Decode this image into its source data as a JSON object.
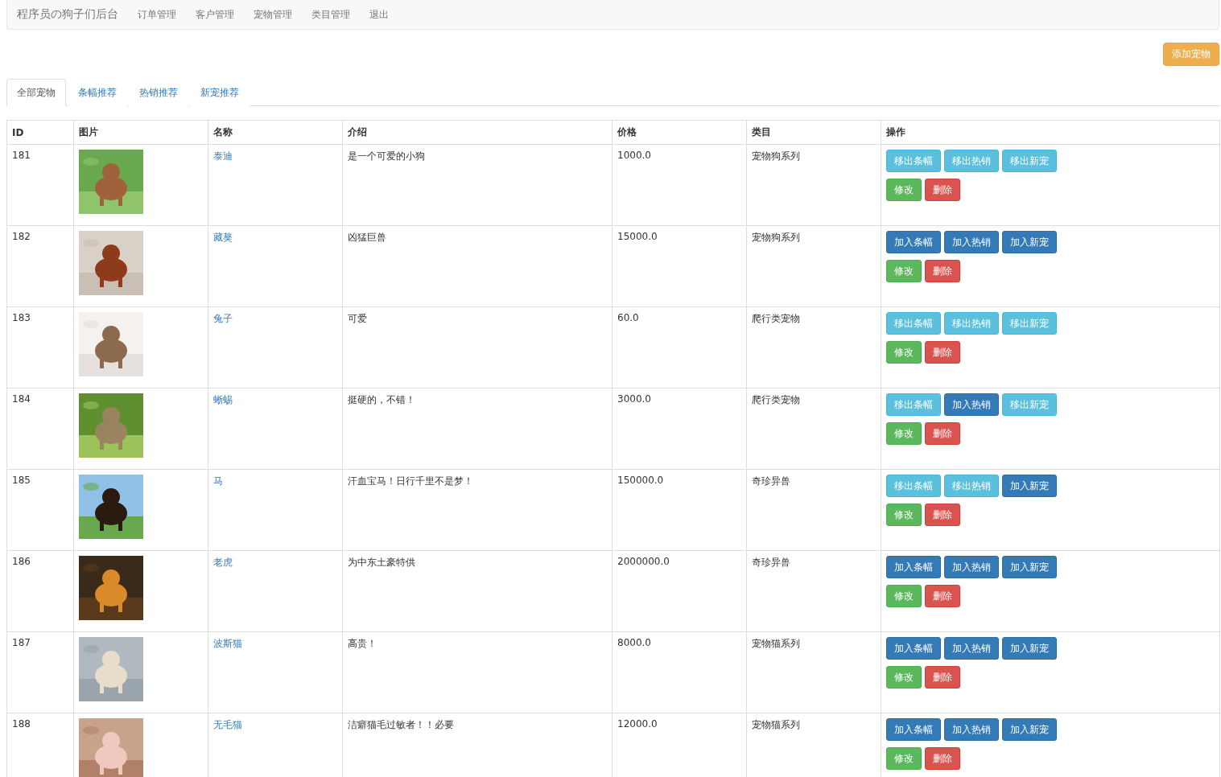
{
  "navbar": {
    "brand": "程序员の狗子们后台",
    "items": [
      "订单管理",
      "客户管理",
      "宠物管理",
      "类目管理",
      "退出"
    ]
  },
  "add_button": "添加宠物",
  "tabs": [
    {
      "label": "全部宠物",
      "selected": true
    },
    {
      "label": "条幅推荐",
      "selected": false
    },
    {
      "label": "热销推荐",
      "selected": false
    },
    {
      "label": "新宠推荐",
      "selected": false
    }
  ],
  "table": {
    "columns": [
      "ID",
      "图片",
      "名称",
      "介绍",
      "价格",
      "类目",
      "操作"
    ],
    "rows": [
      {
        "id": "181",
        "name": "泰迪",
        "intro": "是一个可爱的小狗",
        "price": "1000.0",
        "category": "宠物狗系列",
        "actions": [
          {
            "label": "移出条幅",
            "kind": "remove"
          },
          {
            "label": "移出热销",
            "kind": "remove"
          },
          {
            "label": "移出新宠",
            "kind": "remove"
          },
          {
            "label": "修改",
            "kind": "edit"
          },
          {
            "label": "删除",
            "kind": "delete"
          }
        ]
      },
      {
        "id": "182",
        "name": "藏獒",
        "intro": "凶猛巨兽",
        "price": "15000.0",
        "category": "宠物狗系列",
        "actions": [
          {
            "label": "加入条幅",
            "kind": "add"
          },
          {
            "label": "加入热销",
            "kind": "add"
          },
          {
            "label": "加入新宠",
            "kind": "add"
          },
          {
            "label": "修改",
            "kind": "edit"
          },
          {
            "label": "删除",
            "kind": "delete"
          }
        ]
      },
      {
        "id": "183",
        "name": "兔子",
        "intro": "可爱",
        "price": "60.0",
        "category": "爬行类宠物",
        "actions": [
          {
            "label": "移出条幅",
            "kind": "remove"
          },
          {
            "label": "移出热销",
            "kind": "remove"
          },
          {
            "label": "移出新宠",
            "kind": "remove"
          },
          {
            "label": "修改",
            "kind": "edit"
          },
          {
            "label": "删除",
            "kind": "delete"
          }
        ]
      },
      {
        "id": "184",
        "name": "蜥蜴",
        "intro": "挺硬的，不错！",
        "price": "3000.0",
        "category": "爬行类宠物",
        "actions": [
          {
            "label": "移出条幅",
            "kind": "remove"
          },
          {
            "label": "加入热销",
            "kind": "add"
          },
          {
            "label": "移出新宠",
            "kind": "remove"
          },
          {
            "label": "修改",
            "kind": "edit"
          },
          {
            "label": "删除",
            "kind": "delete"
          }
        ]
      },
      {
        "id": "185",
        "name": "马",
        "intro": "汗血宝马！日行千里不是梦！",
        "price": "150000.0",
        "category": "奇珍异兽",
        "actions": [
          {
            "label": "移出条幅",
            "kind": "remove"
          },
          {
            "label": "移出热销",
            "kind": "remove"
          },
          {
            "label": "加入新宠",
            "kind": "add"
          },
          {
            "label": "修改",
            "kind": "edit"
          },
          {
            "label": "删除",
            "kind": "delete"
          }
        ]
      },
      {
        "id": "186",
        "name": "老虎",
        "intro": "为中东土豪特供",
        "price": "2000000.0",
        "category": "奇珍异兽",
        "actions": [
          {
            "label": "加入条幅",
            "kind": "add"
          },
          {
            "label": "加入热销",
            "kind": "add"
          },
          {
            "label": "加入新宠",
            "kind": "add"
          },
          {
            "label": "修改",
            "kind": "edit"
          },
          {
            "label": "删除",
            "kind": "delete"
          }
        ]
      },
      {
        "id": "187",
        "name": "波斯猫",
        "intro": "高贵！",
        "price": "8000.0",
        "category": "宠物猫系列",
        "actions": [
          {
            "label": "加入条幅",
            "kind": "add"
          },
          {
            "label": "加入热销",
            "kind": "add"
          },
          {
            "label": "加入新宠",
            "kind": "add"
          },
          {
            "label": "修改",
            "kind": "edit"
          },
          {
            "label": "删除",
            "kind": "delete"
          }
        ]
      },
      {
        "id": "188",
        "name": "无毛猫",
        "intro": "洁癖猫毛过敏者！！必要",
        "price": "12000.0",
        "category": "宠物猫系列",
        "actions": [
          {
            "label": "加入条幅",
            "kind": "add"
          },
          {
            "label": "加入热销",
            "kind": "add"
          },
          {
            "label": "加入新宠",
            "kind": "add"
          },
          {
            "label": "修改",
            "kind": "edit"
          },
          {
            "label": "删除",
            "kind": "delete"
          }
        ]
      }
    ]
  }
}
